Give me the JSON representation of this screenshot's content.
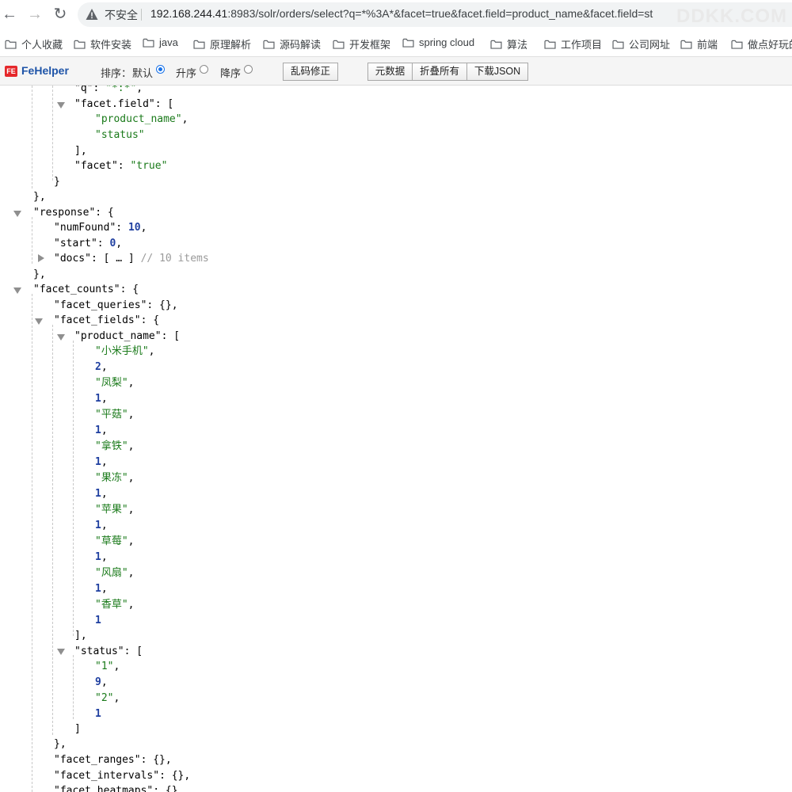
{
  "address_bar": {
    "security_label": "不安全",
    "url_host": "192.168.244.41",
    "url_rest": ":8983/solr/orders/select?q=*%3A*&facet=true&facet.field=product_name&facet.field=st",
    "watermark": "DDKK.COM"
  },
  "bookmarks": [
    "个人收藏",
    "软件安装",
    "java",
    "原理解析",
    "源码解读",
    "开发框架",
    "spring cloud",
    "算法",
    "工作项目",
    "公司网址",
    "前端",
    "做点好玩的"
  ],
  "fehelper": {
    "name": "FeHelper",
    "sort_label": "排序：",
    "sort_default": "默认",
    "sort_asc": "升序",
    "sort_desc": "降序",
    "btn_fix_encoding": "乱码修正",
    "btn_metadata": "元数据",
    "btn_collapse_all": "折叠所有",
    "btn_download_json": "下载JSON"
  },
  "json_view": {
    "lines": [
      [
        {
          "t": "k",
          "v": "\"q\""
        },
        {
          "t": "k",
          "v": ": "
        },
        {
          "t": "s",
          "v": "\"*:*\""
        },
        {
          "t": "k",
          "v": ","
        }
      ],
      [
        {
          "t": "k",
          "v": "\"facet.field\""
        },
        {
          "t": "k",
          "v": ": ["
        }
      ],
      [
        {
          "t": "s",
          "v": "\"product_name\""
        },
        {
          "t": "k",
          "v": ","
        }
      ],
      [
        {
          "t": "s",
          "v": "\"status\""
        }
      ],
      [
        {
          "t": "k",
          "v": "],"
        }
      ],
      [
        {
          "t": "k",
          "v": "\"facet\""
        },
        {
          "t": "k",
          "v": ": "
        },
        {
          "t": "s",
          "v": "\"true\""
        }
      ],
      [
        {
          "t": "k",
          "v": "}"
        }
      ],
      [
        {
          "t": "k",
          "v": "},"
        }
      ],
      [
        {
          "t": "k",
          "v": "\"response\""
        },
        {
          "t": "k",
          "v": ": {"
        }
      ],
      [
        {
          "t": "k",
          "v": "\"numFound\""
        },
        {
          "t": "k",
          "v": ": "
        },
        {
          "t": "n",
          "v": "10"
        },
        {
          "t": "k",
          "v": ","
        }
      ],
      [
        {
          "t": "k",
          "v": "\"start\""
        },
        {
          "t": "k",
          "v": ": "
        },
        {
          "t": "n",
          "v": "0"
        },
        {
          "t": "k",
          "v": ","
        }
      ],
      [
        {
          "t": "k",
          "v": "\"docs\""
        },
        {
          "t": "k",
          "v": ": [ … ] "
        },
        {
          "t": "c",
          "v": "// 10 items"
        }
      ],
      [
        {
          "t": "k",
          "v": "},"
        }
      ],
      [
        {
          "t": "k",
          "v": "\"facet_counts\""
        },
        {
          "t": "k",
          "v": ": {"
        }
      ],
      [
        {
          "t": "k",
          "v": "\"facet_queries\""
        },
        {
          "t": "k",
          "v": ": {},"
        }
      ],
      [
        {
          "t": "k",
          "v": "\"facet_fields\""
        },
        {
          "t": "k",
          "v": ": {"
        }
      ],
      [
        {
          "t": "k",
          "v": "\"product_name\""
        },
        {
          "t": "k",
          "v": ": ["
        }
      ],
      [
        {
          "t": "s",
          "v": "\"小米手机\""
        },
        {
          "t": "k",
          "v": ","
        }
      ],
      [
        {
          "t": "n",
          "v": "2"
        },
        {
          "t": "k",
          "v": ","
        }
      ],
      [
        {
          "t": "s",
          "v": "\"凤梨\""
        },
        {
          "t": "k",
          "v": ","
        }
      ],
      [
        {
          "t": "n",
          "v": "1"
        },
        {
          "t": "k",
          "v": ","
        }
      ],
      [
        {
          "t": "s",
          "v": "\"平菇\""
        },
        {
          "t": "k",
          "v": ","
        }
      ],
      [
        {
          "t": "n",
          "v": "1"
        },
        {
          "t": "k",
          "v": ","
        }
      ],
      [
        {
          "t": "s",
          "v": "\"拿铁\""
        },
        {
          "t": "k",
          "v": ","
        }
      ],
      [
        {
          "t": "n",
          "v": "1"
        },
        {
          "t": "k",
          "v": ","
        }
      ],
      [
        {
          "t": "s",
          "v": "\"果冻\""
        },
        {
          "t": "k",
          "v": ","
        }
      ],
      [
        {
          "t": "n",
          "v": "1"
        },
        {
          "t": "k",
          "v": ","
        }
      ],
      [
        {
          "t": "s",
          "v": "\"苹果\""
        },
        {
          "t": "k",
          "v": ","
        }
      ],
      [
        {
          "t": "n",
          "v": "1"
        },
        {
          "t": "k",
          "v": ","
        }
      ],
      [
        {
          "t": "s",
          "v": "\"草莓\""
        },
        {
          "t": "k",
          "v": ","
        }
      ],
      [
        {
          "t": "n",
          "v": "1"
        },
        {
          "t": "k",
          "v": ","
        }
      ],
      [
        {
          "t": "s",
          "v": "\"风扇\""
        },
        {
          "t": "k",
          "v": ","
        }
      ],
      [
        {
          "t": "n",
          "v": "1"
        },
        {
          "t": "k",
          "v": ","
        }
      ],
      [
        {
          "t": "s",
          "v": "\"香草\""
        },
        {
          "t": "k",
          "v": ","
        }
      ],
      [
        {
          "t": "n",
          "v": "1"
        }
      ],
      [
        {
          "t": "k",
          "v": "],"
        }
      ],
      [
        {
          "t": "k",
          "v": "\"status\""
        },
        {
          "t": "k",
          "v": ": ["
        }
      ],
      [
        {
          "t": "s",
          "v": "\"1\""
        },
        {
          "t": "k",
          "v": ","
        }
      ],
      [
        {
          "t": "n",
          "v": "9"
        },
        {
          "t": "k",
          "v": ","
        }
      ],
      [
        {
          "t": "s",
          "v": "\"2\""
        },
        {
          "t": "k",
          "v": ","
        }
      ],
      [
        {
          "t": "n",
          "v": "1"
        }
      ],
      [
        {
          "t": "k",
          "v": "]"
        }
      ],
      [
        {
          "t": "k",
          "v": "},"
        }
      ],
      [
        {
          "t": "k",
          "v": "\"facet_ranges\""
        },
        {
          "t": "k",
          "v": ": {},"
        }
      ],
      [
        {
          "t": "k",
          "v": "\"facet_intervals\""
        },
        {
          "t": "k",
          "v": ": {},"
        }
      ],
      [
        {
          "t": "k",
          "v": "\"facet_heatmaps\""
        },
        {
          "t": "k",
          "v": ": {}"
        }
      ]
    ]
  }
}
